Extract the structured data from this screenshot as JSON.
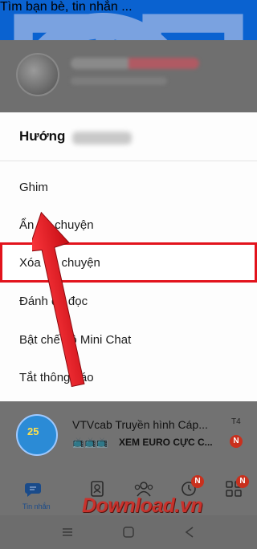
{
  "search": {
    "placeholder": "Tìm bạn bè, tin nhắn ..."
  },
  "sheet": {
    "title": "Hướng",
    "items": [
      {
        "label": "Ghim"
      },
      {
        "label": "Ẩn trò chuyện"
      },
      {
        "label": "Xóa trò chuyện"
      },
      {
        "label": "Đánh      đã đọc"
      },
      {
        "label": "Bật chế độ Mini Chat"
      },
      {
        "label": "Tắt thông báo"
      }
    ]
  },
  "conversation": {
    "avatar_text": "25",
    "name": "VTVcab Truyền hình Cáp...",
    "emoji": "📺📺📺",
    "message": "XEM EURO CỰC C...",
    "time": "T4",
    "badge": "N"
  },
  "bottom_nav": {
    "messages_label": "Tin nhắn",
    "timeline_badge": "N",
    "more_badge": "N"
  },
  "watermark": {
    "text": "Download.vn"
  },
  "colors": {
    "accent": "#0a62d0",
    "highlight": "#e2131c",
    "arrow": "#e8141c",
    "badge": "#c9301d"
  }
}
